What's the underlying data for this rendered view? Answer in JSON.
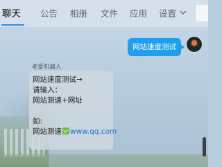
{
  "tabs": [
    {
      "label": "聊天",
      "active": true
    },
    {
      "label": "公告",
      "active": false
    },
    {
      "label": "相册",
      "active": false
    },
    {
      "label": "文件",
      "active": false
    },
    {
      "label": "应用",
      "active": false
    },
    {
      "label": "设置",
      "active": false
    }
  ],
  "colors": {
    "accent": "#1e9ff2",
    "link": "#1c6fcf",
    "underline": "#2b8be6"
  },
  "messages": {
    "sent_text": "网站速度测试",
    "bot_name": "老爱机器人",
    "reply_lines": [
      "网站速度测试→",
      "请输入：",
      "网站测速+网址",
      "",
      "如:"
    ],
    "example_prefix": "网站测速",
    "example_link": "www.qq.com"
  }
}
